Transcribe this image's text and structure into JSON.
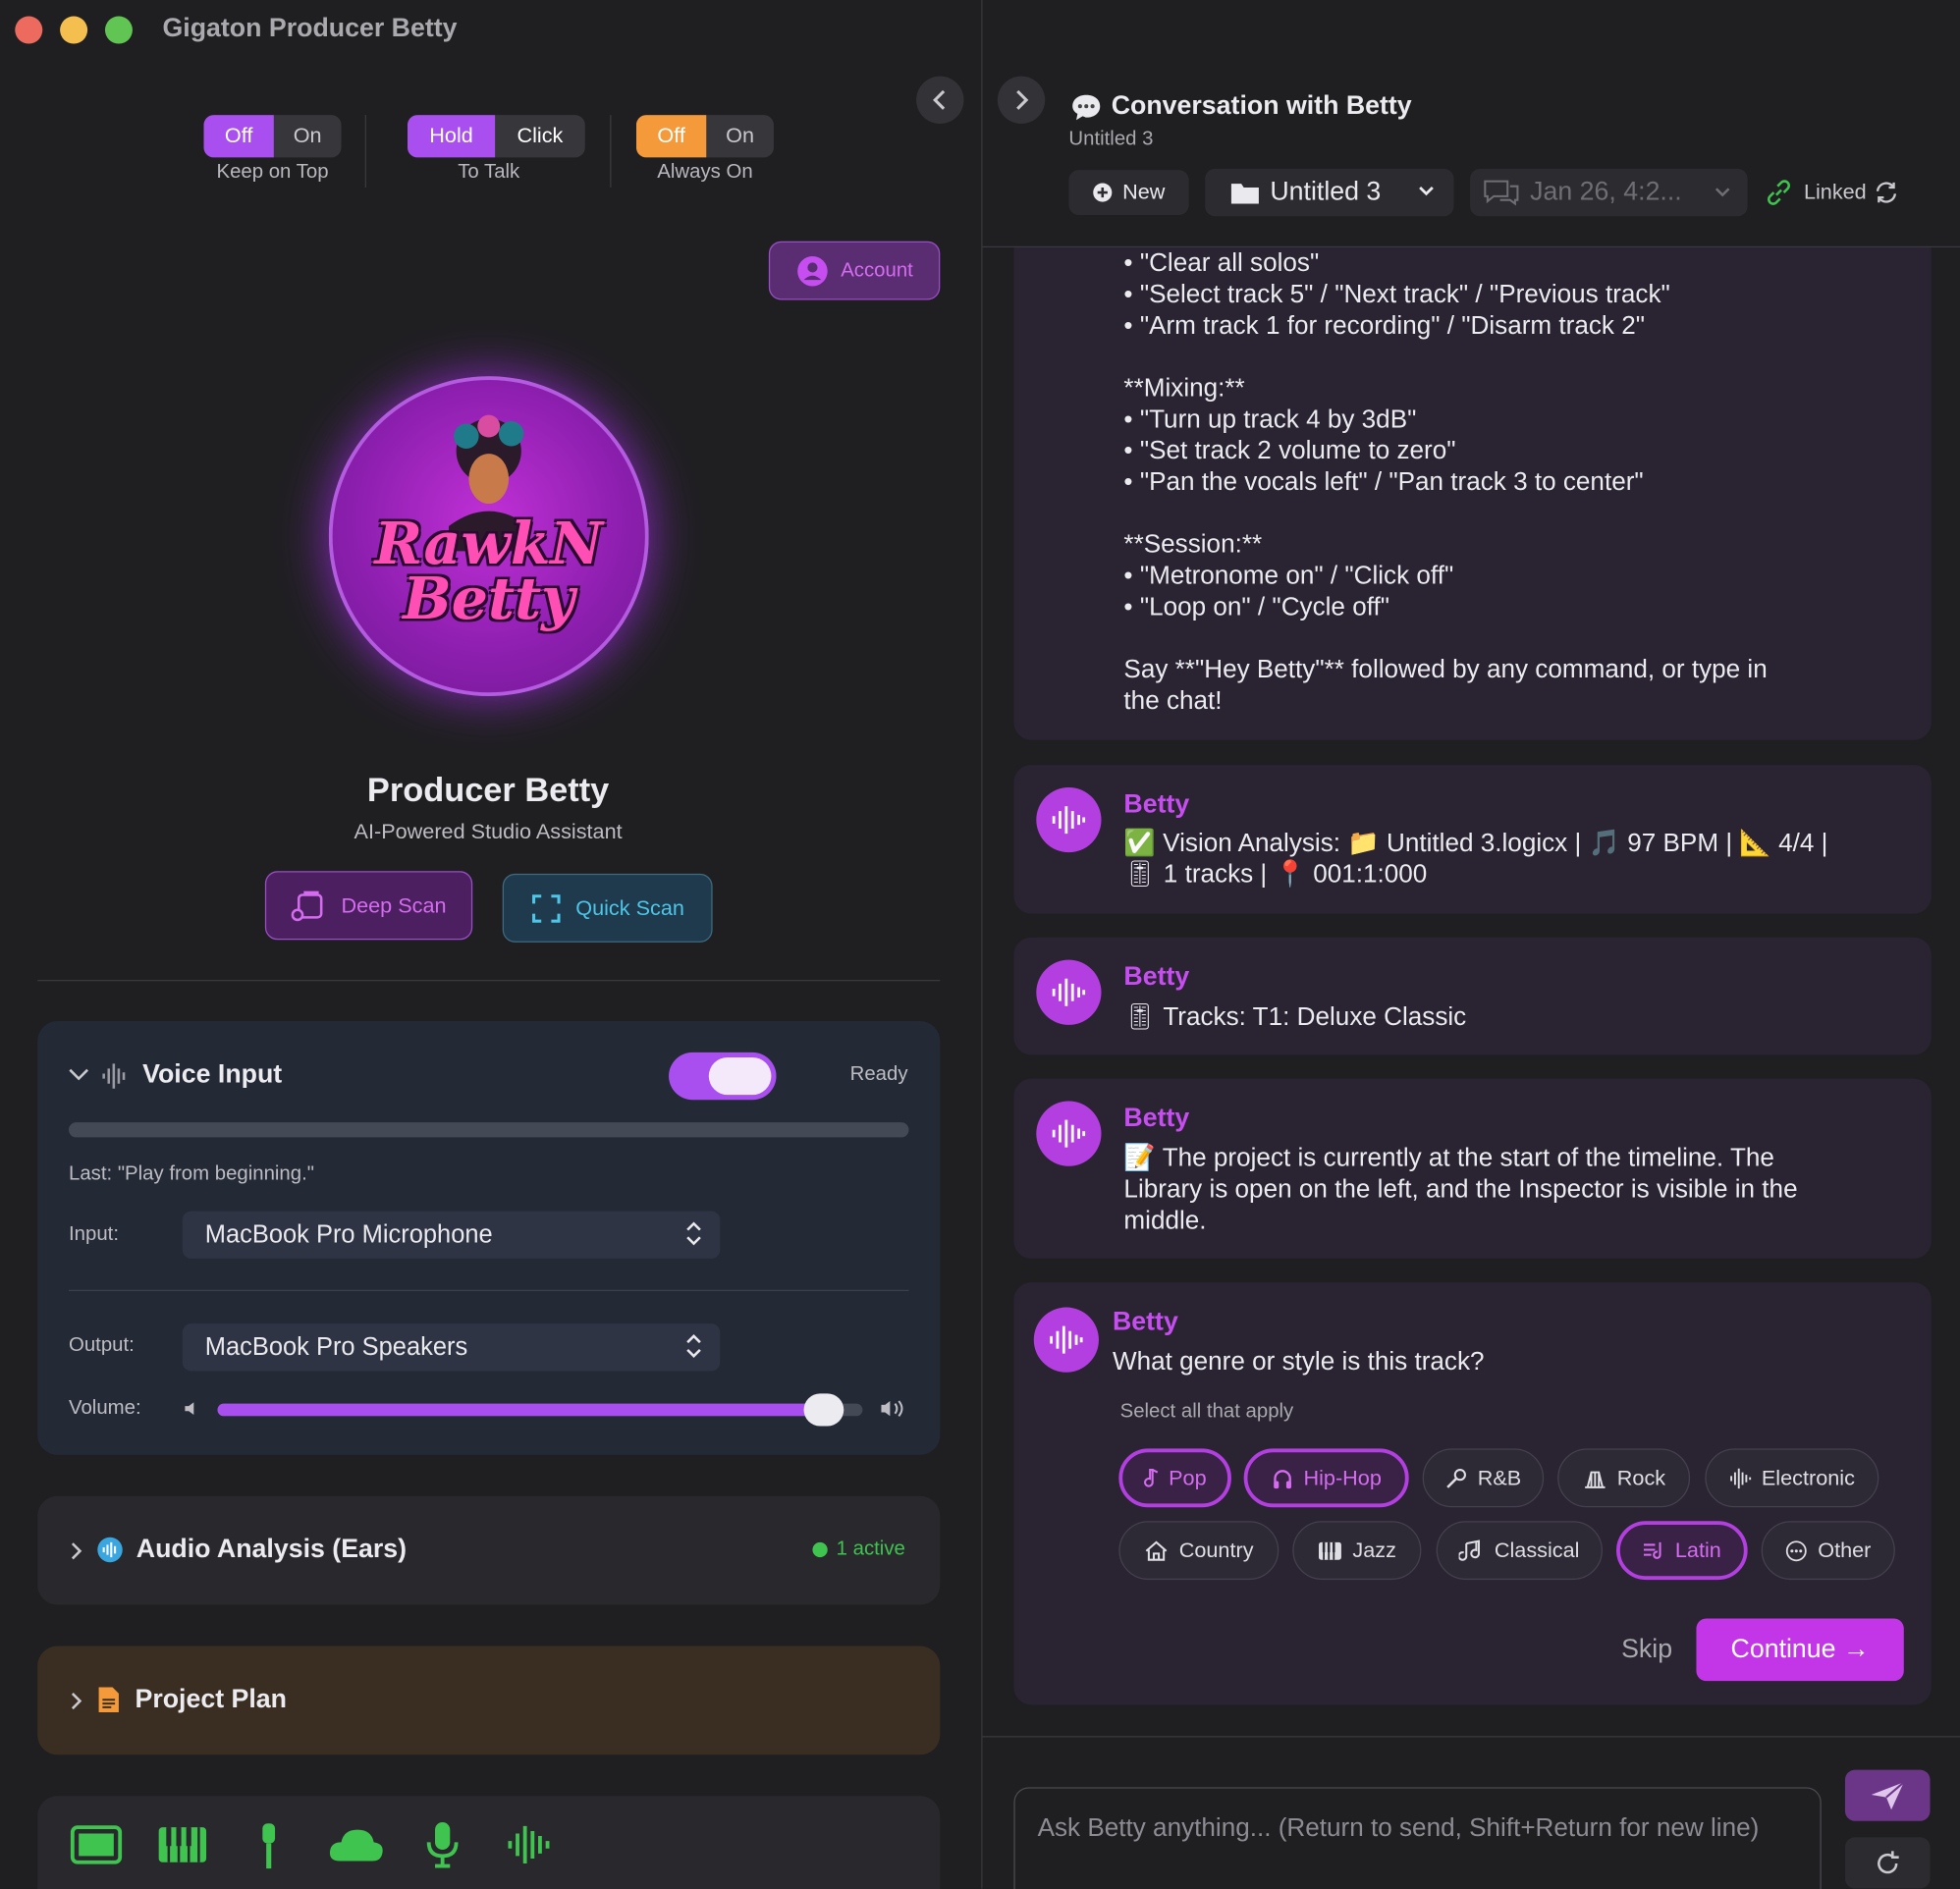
{
  "app": {
    "title": "Gigaton Producer Betty"
  },
  "top_toggles": [
    {
      "options": [
        "Off",
        "On"
      ],
      "selected": "Off",
      "caption": "Keep on Top"
    },
    {
      "options": [
        "Hold",
        "Click"
      ],
      "selected": "Hold",
      "caption": "To Talk"
    },
    {
      "options": [
        "Off",
        "On"
      ],
      "selected": "Off",
      "caption": "Always On"
    }
  ],
  "account": {
    "label": "Account"
  },
  "profile": {
    "logo_text": "RawkN Betty",
    "name": "Producer Betty",
    "subtitle": "AI-Powered Studio Assistant"
  },
  "scan": {
    "deep": "Deep Scan",
    "quick": "Quick Scan"
  },
  "voice": {
    "title": "Voice Input",
    "status": "Ready",
    "enabled": true,
    "last": "Last: \"Play from beginning.\"",
    "input_label": "Input:",
    "input_value": "MacBook Pro Microphone",
    "output_label": "Output:",
    "output_value": "MacBook Pro Speakers",
    "volume_label": "Volume:",
    "volume_level": 0.94
  },
  "audio_analysis": {
    "title": "Audio Analysis (Ears)",
    "status": "1 active"
  },
  "project_plan": {
    "title": "Project Plan"
  },
  "dock_icons": [
    "screen-icon",
    "piano-icon",
    "mic-stand-icon",
    "cloud-icon",
    "microphone-icon",
    "waveform-icon"
  ],
  "colors": {
    "accent": "#a94ff0",
    "orange": "#f59a3a",
    "green": "#3fc44f",
    "betty": "#c64df0"
  },
  "conversation": {
    "title": "Conversation with Betty",
    "subtitle": "Untitled 3",
    "new_label": "New",
    "project": "Untitled 3",
    "session": "Jan 26, 4:2...",
    "linked": "Linked"
  },
  "messages": {
    "intro_text": "• \"Clear all solos\"\n• \"Select track 5\" / \"Next track\" / \"Previous track\"\n• \"Arm track 1 for recording\" / \"Disarm track 2\"\n\n**Mixing:**\n• \"Turn up track 4 by 3dB\"\n• \"Set track 2 volume to zero\"\n• \"Pan the vocals left\" / \"Pan track 3 to center\"\n\n**Session:**\n• \"Metronome on\" / \"Click off\"\n• \"Loop on\" / \"Cycle off\"\n\nSay **\"Hey Betty\"** followed by any command, or type in\nthe chat!",
    "items": [
      {
        "sender": "Betty",
        "text": "✅ Vision Analysis: 📁 Untitled 3.logicx | 🎵 97 BPM | 📐 4/4 |\n🎚 1 tracks | 📍 001:1:000"
      },
      {
        "sender": "Betty",
        "text": "🎚 Tracks: T1: Deluxe Classic"
      },
      {
        "sender": "Betty",
        "text": "📝 The project is currently at the start of the timeline. The\nLibrary is open on the left, and the Inspector is visible in the\nmiddle."
      }
    ]
  },
  "question": {
    "sender": "Betty",
    "text": "What genre or style is this track?",
    "hint": "Select all that apply",
    "options": [
      {
        "label": "Pop",
        "selected": true,
        "icon": "note-icon"
      },
      {
        "label": "Hip-Hop",
        "selected": true,
        "icon": "headphones-icon"
      },
      {
        "label": "R&B",
        "selected": false,
        "icon": "mic-icon"
      },
      {
        "label": "Rock",
        "selected": false,
        "icon": "amp-icon"
      },
      {
        "label": "Electronic",
        "selected": false,
        "icon": "waveform-icon"
      },
      {
        "label": "Country",
        "selected": false,
        "icon": "house-icon"
      },
      {
        "label": "Jazz",
        "selected": false,
        "icon": "piano-icon"
      },
      {
        "label": "Classical",
        "selected": false,
        "icon": "notes-icon"
      },
      {
        "label": "Latin",
        "selected": true,
        "icon": "list-note-icon"
      },
      {
        "label": "Other",
        "selected": false,
        "icon": "ellipsis-icon"
      }
    ],
    "skip": "Skip",
    "continue": "Continue →"
  },
  "composer": {
    "placeholder": "Ask Betty anything... (Return to send, Shift+Return for new line)"
  }
}
